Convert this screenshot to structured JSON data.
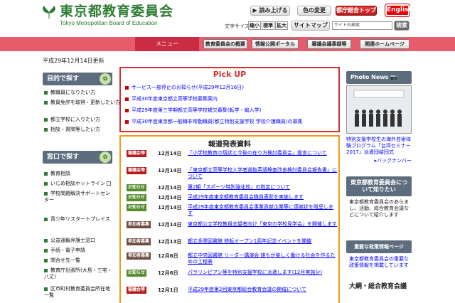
{
  "header": {
    "logo_text": "東京都教育委員会",
    "logo_english": "Tokyo Metropolitan Board of Education",
    "read_aloud": "読み上げる",
    "color_change": "色の変更",
    "tokyo_top": "都庁総合トップ",
    "english": "English",
    "font_size_label": "文字サイズ",
    "font_small": "縮小",
    "font_standard": "標準",
    "font_large": "拡大",
    "sitemap": "サイトマップ",
    "search_placeholder": "サイト内検索",
    "search_button": "検索"
  },
  "nav": {
    "menu": "メニュー",
    "items": [
      "教育委員会の概要",
      "情報公開ポータル",
      "審議会議事録等",
      "関連ホームページ"
    ]
  },
  "updated": "平成29年12月14日更新",
  "left": {
    "purpose_title": "目的で探す",
    "purpose_items": [
      "教職員になりたい方",
      "教員免許を取得・更新したい方",
      "都立学校に入りたい方",
      "相談・質問等したい方"
    ],
    "window_title": "窓口で探す",
    "window_items": [
      "教育相談",
      "いじめ相談ホットライン",
      "学校問題解決サポートセンター",
      "青少年リスタートプレイス",
      "公益通報弁護士窓口",
      "手続・電子申請",
      "問合せ先一覧",
      "教育庁出張所(大島・三宅・八丈)",
      "区市町村教育委員会所在地一覧"
    ]
  },
  "pickup": {
    "title": "Pick UP",
    "items": [
      "サービス一部停止のお知らせ(平成29年12月16日)",
      "平成30年度東京都立高等学校募集案内",
      "平成29年度第三学期都立高等学校補欠募集(転学・編入学)",
      "平成30年度東京都一般職非常勤職員(都立特別支援学校 学校介護職員)の募集"
    ]
  },
  "press": {
    "title": "報道発表資料",
    "rows": [
      {
        "tag": "審議会等",
        "date": "12月14日",
        "text": "「小学校教育の現状と今後の在り方検討委員会」提言について"
      },
      {
        "tag": "審議会等",
        "date": "12月14日",
        "text": "「東京都立高等学校入学者選抜英語検査改善検討委員会報告書」について"
      },
      {
        "tag": "お知らせ",
        "date": "12月14日",
        "text": "第2期「スポーツ特別強化校」の指定について"
      },
      {
        "tag": "お知らせ",
        "date": "12月14日",
        "text": "平成29年度東京都教育委員会職員表彰を実施します"
      },
      {
        "tag": "お知らせ",
        "date": "12月14日",
        "text": "平成29年度東京都教育委員会事業貢献企業等に感謝状を贈呈します"
      },
      {
        "tag": "参加者募集",
        "date": "12月14日",
        "text": "東京都公立学校教員志望者向け「東京の学校見学会」を開催します"
      },
      {
        "tag": "参加者募集",
        "date": "12月13日",
        "text": "都立多摩図書館 移転オープン1周年記念イベントを開催"
      },
      {
        "tag": "参加者募集",
        "date": "12月6日",
        "text": "都立中央図書館 リーダー講演会 誰もが楽しく働ける社会を作るための工程表"
      },
      {
        "tag": "お知らせ",
        "date": "12月6日",
        "text": "パラリンピアン等を特別支援学校に派遣します(12月実施分)"
      },
      {
        "tag": "審議会等",
        "date": "12月1日",
        "text": "平成29年度第2回東京都総合教育会議の開催について"
      }
    ]
  },
  "right": {
    "photo_news": "Photo News",
    "photo_caption": "特別支援学校生の海外芸術体験プログラム「台湾セミナー2017」派遣団結団式",
    "back_number": "バックナンバー",
    "know_title": "東京都教育委員会について知りたい",
    "know_text": "東京都教育委員会のあらまし、活動、総合教育会議などについて紹介します",
    "policy_title": "重要な政策情報ページ",
    "policy_text": "東京都教育委員会の重要な政策情報を掲載しています",
    "general_title": "大綱・総合教育会議"
  }
}
